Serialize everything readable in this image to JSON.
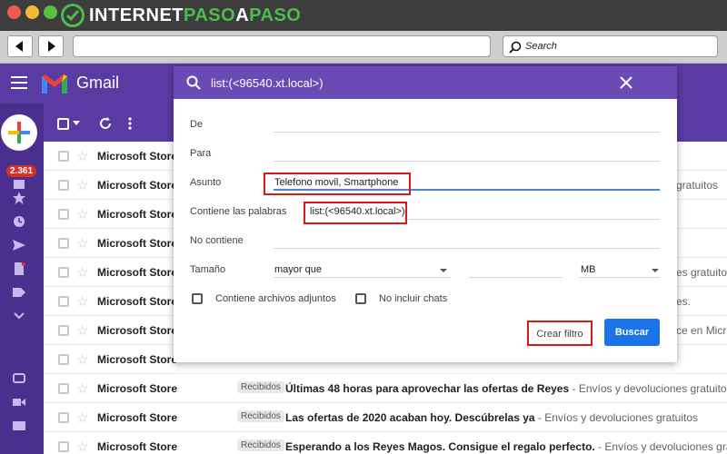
{
  "site": {
    "brand_white_1": "INTERNET",
    "brand_green_1": "PASO",
    "brand_white_2": "A",
    "brand_green_2": "PASO"
  },
  "browser": {
    "search_placeholder": "Search"
  },
  "gmail": {
    "app_name": "Gmail",
    "unread_badge": "2.361"
  },
  "dialog": {
    "query": "list:(<96540.xt.local>)",
    "fields": {
      "from_label": "De",
      "to_label": "Para",
      "subject_label": "Asunto",
      "subject_value": "Telefono movil, Smartphone",
      "has_words_label": "Contiene las palabras",
      "has_words_value": "list:(<96540.xt.local>)",
      "doesnt_have_label": "No contiene",
      "size_label": "Tamaño",
      "size_operator": "mayor que",
      "size_unit": "MB"
    },
    "checkboxes": {
      "attachments": "Contiene archivos adjuntos",
      "no_chats": "No incluir chats"
    },
    "buttons": {
      "create_filter": "Crear filtro",
      "search": "Buscar"
    }
  },
  "emails": [
    {
      "sender": "Microsoft Store",
      "tail": ""
    },
    {
      "sender": "Microsoft Store",
      "tail": "gratuitos"
    },
    {
      "sender": "Microsoft Store",
      "tail": ""
    },
    {
      "sender": "Microsoft Store",
      "tail": ""
    },
    {
      "sender": "Microsoft Store",
      "tail": "es gratuitos"
    },
    {
      "sender": "Microsoft Store",
      "tail": "es."
    },
    {
      "sender": "Microsoft Store",
      "tail": "ce en Micro"
    },
    {
      "sender": "Microsoft Store",
      "tail": ""
    },
    {
      "sender": "Microsoft Store",
      "label": "Recibidos",
      "subject": "Últimas 48 horas para aprovechar las ofertas de Reyes",
      "snippet": " - Envíos y devoluciones gratuitos"
    },
    {
      "sender": "Microsoft Store",
      "label": "Recibidos",
      "subject": "Las ofertas de 2020 acaban hoy. Descúbrelas ya",
      "snippet": " - Envíos y devoluciones gratuitos"
    },
    {
      "sender": "Microsoft Store",
      "label": "Recibidos",
      "subject": "Esperando a los Reyes Magos. Consigue el regalo perfecto.",
      "snippet": " - Envíos y devoluciones gratuitos"
    }
  ],
  "colors": {
    "gmail_purple": "#5a3aa3",
    "highlight_red": "#d51a1a",
    "search_blue": "#1a73e8",
    "brand_green": "#4dbd4a"
  }
}
